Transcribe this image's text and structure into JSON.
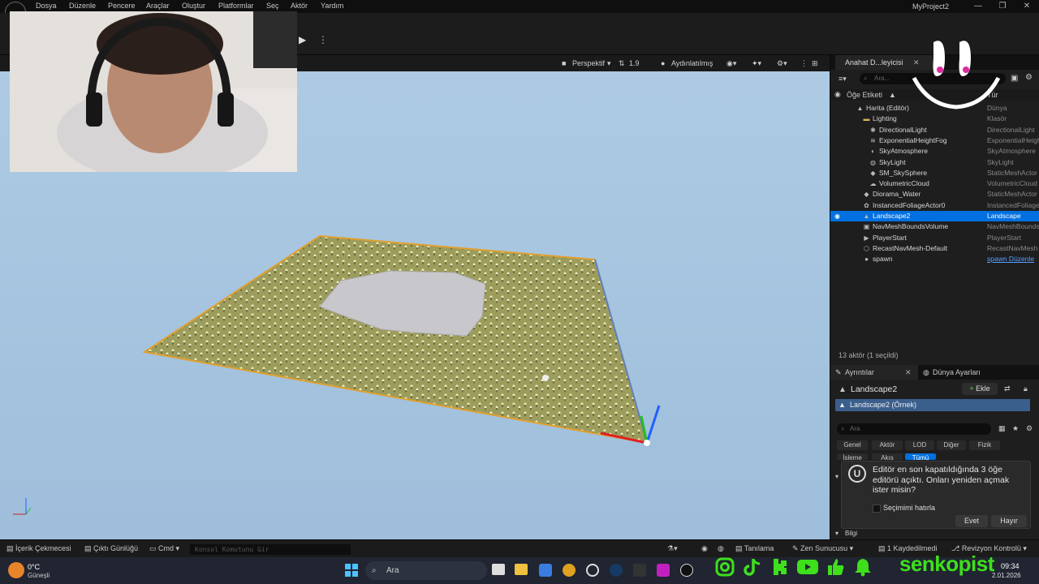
{
  "menu": [
    "Dosya",
    "Düzenle",
    "Pencere",
    "Araçlar",
    "Oluştur",
    "Platformlar",
    "Seç",
    "Aktör",
    "Yardım"
  ],
  "window_title": "MyProject2",
  "viewport_toolbar": {
    "perspective": "Perspektif",
    "fov": "1.9",
    "lighting": "Aydınlatılmış"
  },
  "outliner": {
    "tab_label": "Anahat D...leyicisi",
    "search_placeholder": "Ara...",
    "col_label": "Öğe Etiketi",
    "col_type": "Tür",
    "rows": [
      {
        "label": "Harita (Editör)",
        "type": "Dünya",
        "indent": 1,
        "icon": "map-icon"
      },
      {
        "label": "Lighting",
        "type": "Klasör",
        "indent": 2,
        "icon": "folder-icon"
      },
      {
        "label": "DirectionalLight",
        "type": "DirectionalLight",
        "indent": 3,
        "icon": "light-icon"
      },
      {
        "label": "ExponentialHeightFog",
        "type": "ExponentialHeigh",
        "indent": 3,
        "icon": "fog-icon"
      },
      {
        "label": "SkyAtmosphere",
        "type": "SkyAtmosphere",
        "indent": 3,
        "icon": "sky-icon"
      },
      {
        "label": "SkyLight",
        "type": "SkyLight",
        "indent": 3,
        "icon": "skylight-icon"
      },
      {
        "label": "SM_SkySphere",
        "type": "StaticMeshActor",
        "indent": 3,
        "icon": "mesh-icon"
      },
      {
        "label": "VolumetricCloud",
        "type": "VolumetricCloud",
        "indent": 3,
        "icon": "cloud-icon"
      },
      {
        "label": "Diorama_Water",
        "type": "StaticMeshActor",
        "indent": 2,
        "icon": "mesh-icon"
      },
      {
        "label": "InstancedFoliageActor0",
        "type": "InstancedFoliage",
        "indent": 2,
        "icon": "foliage-icon"
      },
      {
        "label": "Landscape2",
        "type": "Landscape",
        "indent": 2,
        "icon": "landscape-icon",
        "selected": true
      },
      {
        "label": "NavMeshBoundsVolume",
        "type": "NavMeshBounds",
        "indent": 2,
        "icon": "volume-icon"
      },
      {
        "label": "PlayerStart",
        "type": "PlayerStart",
        "indent": 2,
        "icon": "player-icon"
      },
      {
        "label": "RecastNavMesh-Default",
        "type": "RecastNavMesh",
        "indent": 2,
        "icon": "navmesh-icon"
      },
      {
        "label": "spawn",
        "type": "spawn Düzenle",
        "indent": 2,
        "icon": "actor-icon",
        "link": true
      }
    ],
    "actor_count": "13 aktör (1 seçildi)"
  },
  "details": {
    "tab_details": "Ayrıntılar",
    "tab_world": "Dünya Ayarları",
    "object_name": "Landscape2",
    "add_label": "Ekle",
    "instance_label": "Landscape2 (Örnek)",
    "search_placeholder": "Ara",
    "filters": [
      "Genel",
      "Aktör",
      "LOD",
      "Diğer",
      "Fizik"
    ],
    "filters_row2": [
      "İşleme",
      "Akış",
      "Tümü"
    ],
    "info_label": "Bilgi"
  },
  "notice": {
    "text": "Editör en son kapatıldığında 3 öğe editörü açıktı. Onları yeniden açmak ister misin?",
    "remember": "Seçimimi hatırla",
    "yes": "Evet",
    "no": "Hayır"
  },
  "statusbar": {
    "content_drawer": "İçerik Çekmecesi",
    "output_log": "Çıktı Günlüğü",
    "cmd": "Cmd",
    "console_placeholder": "Konsol Komutunu Gir",
    "derive": "Tanılama",
    "zen": "Zen Sunucusu",
    "saved": "1 Kaydedilmedi",
    "revision": "Revizyon Kontrolü"
  },
  "taskbar": {
    "weather_temp": "0°C",
    "weather_desc": "Güneşli",
    "search": "Ara",
    "time": "09:34",
    "date": "2.01.2026"
  },
  "overlay": {
    "brand": "senkopist"
  },
  "colors": {
    "selection": "#0070e0",
    "brand_green": "#3ee01c",
    "landscape": "#a3a360",
    "sky": "#aecbe3"
  }
}
